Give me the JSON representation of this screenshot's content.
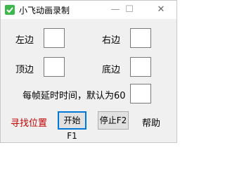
{
  "window": {
    "title": "小飞动画录制"
  },
  "title_buttons": {
    "minimize": "—",
    "maximize": "☐",
    "close": "✕"
  },
  "fields": {
    "left_label": "左边",
    "right_label": "右边",
    "top_label": "顶边",
    "bottom_label": "底边",
    "delay_label": "每帧延时时间，默认为60"
  },
  "actions": {
    "find_position": "寻找位置",
    "start": "开始F1",
    "stop": "停止F2",
    "help": "帮助"
  },
  "colors": {
    "find_position": "#c00000",
    "focus_border": "#0078d7"
  }
}
